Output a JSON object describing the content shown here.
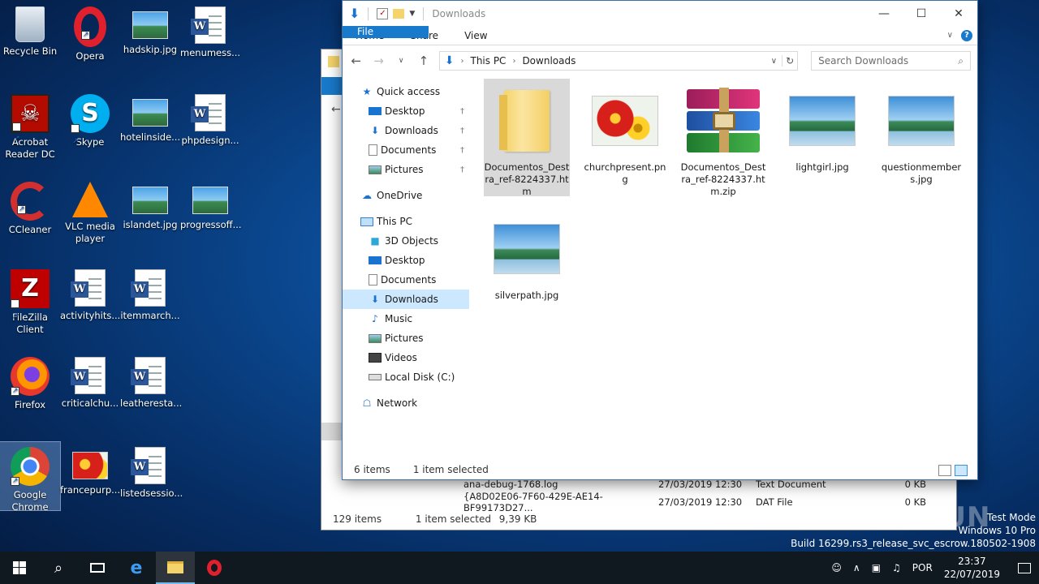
{
  "desktop": {
    "icons": [
      {
        "label": "Recycle Bin"
      },
      {
        "label": "Opera"
      },
      {
        "label": "hadskip.jpg"
      },
      {
        "label": "menumess..."
      },
      {
        "label": "Acrobat Reader DC"
      },
      {
        "label": "Skype"
      },
      {
        "label": "hotelinside..."
      },
      {
        "label": "phpdesign..."
      },
      {
        "label": "CCleaner"
      },
      {
        "label": "VLC media player"
      },
      {
        "label": "islandet.jpg"
      },
      {
        "label": "progressoff..."
      },
      {
        "label": "FileZilla Client"
      },
      {
        "label": "activityhits..."
      },
      {
        "label": "itemmarch..."
      },
      {
        "label": "Firefox"
      },
      {
        "label": "criticalchu..."
      },
      {
        "label": "leatheresta..."
      },
      {
        "label": "Google Chrome"
      },
      {
        "label": "francepurp..."
      },
      {
        "label": "listedsessio..."
      }
    ]
  },
  "bg_window": {
    "rows": [
      {
        "name": "ana-debug-1768.log",
        "date": "27/03/2019 12:30",
        "type": "Text Document",
        "size": "0 KB"
      },
      {
        "name": "{A8D02E06-7F60-429E-AE14-BF99173D27...",
        "date": "27/03/2019 12:30",
        "type": "DAT File",
        "size": "0 KB"
      }
    ],
    "status_items": "129 items",
    "status_selected": "1 item selected",
    "status_size": "9,39 KB"
  },
  "window": {
    "title": "Downloads",
    "ribbon_tabs": [
      "File",
      "Home",
      "Share",
      "View"
    ],
    "breadcrumb": [
      "This PC",
      "Downloads"
    ],
    "search_placeholder": "Search Downloads",
    "nav": {
      "quick_access": "Quick access",
      "qa_items": [
        "Desktop",
        "Downloads",
        "Documents",
        "Pictures"
      ],
      "onedrive": "OneDrive",
      "this_pc": "This PC",
      "pc_items": [
        "3D Objects",
        "Desktop",
        "Documents",
        "Downloads",
        "Music",
        "Pictures",
        "Videos",
        "Local Disk (C:)"
      ],
      "network": "Network"
    },
    "files": [
      {
        "name": "Documentos_Destra_ref-8224337.htm",
        "kind": "folder",
        "selected": true
      },
      {
        "name": "churchpresent.png",
        "kind": "flower",
        "selected": false
      },
      {
        "name": "Documentos_Destra_ref-8224337.htm.zip",
        "kind": "rar",
        "selected": false
      },
      {
        "name": "lightgirl.jpg",
        "kind": "photo",
        "selected": false
      },
      {
        "name": "questionmembers.jpg",
        "kind": "photo",
        "selected": false
      },
      {
        "name": "silverpath.jpg",
        "kind": "photo",
        "selected": false
      }
    ],
    "status_count": "6 items",
    "status_selected": "1 item selected"
  },
  "overlay": {
    "watermark": "ANY RUN",
    "test_mode": "Test Mode",
    "os": "Windows 10 Pro",
    "build": "Build 16299.rs3_release_svc_escrow.180502-1908"
  },
  "taskbar": {
    "lang": "POR",
    "time": "23:37",
    "date": "22/07/2019"
  },
  "colors": {
    "accent": "#1979ca",
    "selection": "#cce8ff",
    "taskbar": "#101820"
  }
}
